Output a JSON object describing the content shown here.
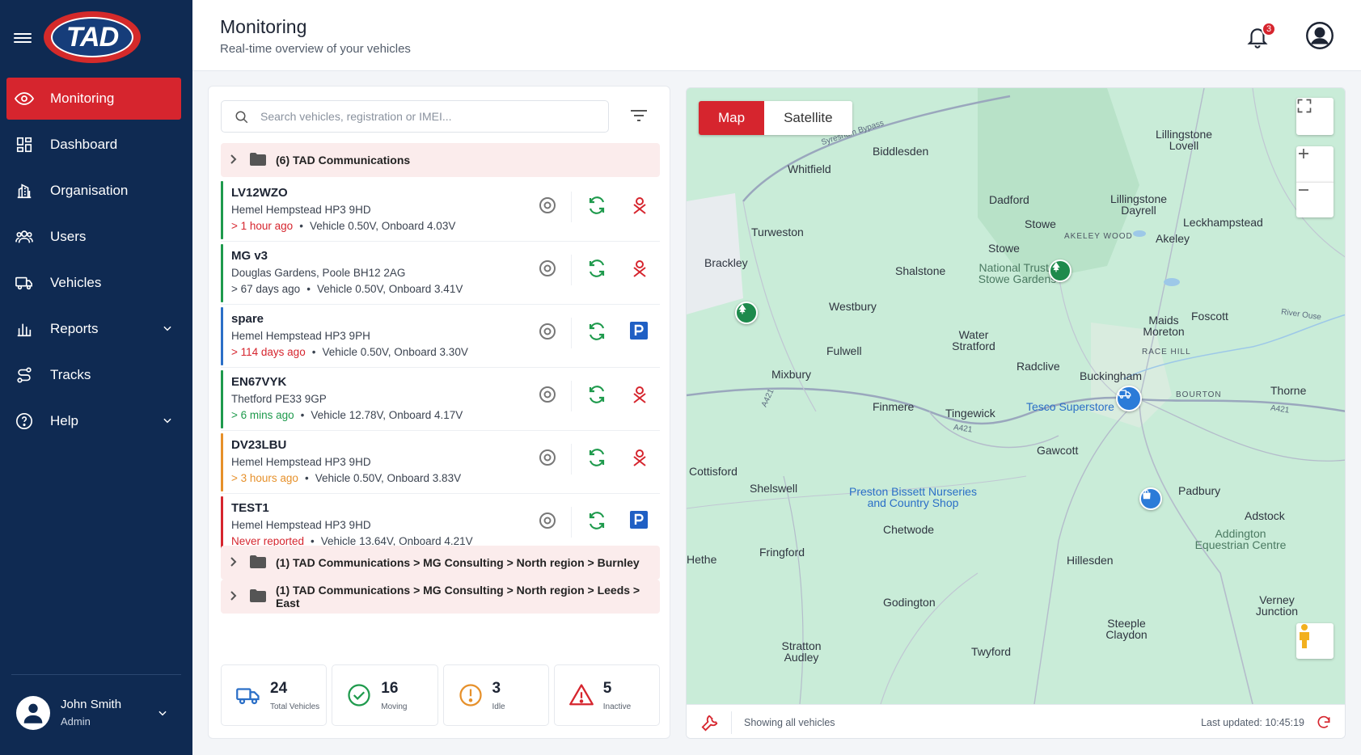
{
  "sidebar": {
    "logo_text": "TAD",
    "items": [
      {
        "label": "Monitoring",
        "icon": "eye-icon",
        "active": true
      },
      {
        "label": "Dashboard",
        "icon": "dashboard-grid-icon"
      },
      {
        "label": "Organisation",
        "icon": "building-icon"
      },
      {
        "label": "Users",
        "icon": "users-icon"
      },
      {
        "label": "Vehicles",
        "icon": "truck-icon"
      },
      {
        "label": "Reports",
        "icon": "bar-chart-icon",
        "expandable": true
      },
      {
        "label": "Tracks",
        "icon": "route-icon"
      },
      {
        "label": "Help",
        "icon": "help-circle-icon",
        "expandable": true
      }
    ],
    "user": {
      "name": "John Smith",
      "role": "Admin"
    }
  },
  "header": {
    "title": "Monitoring",
    "subtitle": "Real-time overview of your vehicles",
    "notification_count": "3"
  },
  "panel": {
    "search_placeholder": "Search vehicles, registration or IMEI...",
    "groups": [
      {
        "label": "(6) TAD Communications"
      },
      {
        "label": "(1) TAD Communications > MG Consulting > North region > Burnley"
      },
      {
        "label": "(1) TAD Communications > MG Consulting > North region > Leeds > East"
      }
    ],
    "vehicles": [
      {
        "name": "LV12WZO",
        "address": "Hemel Hempstead HP3 9HD",
        "time": "> 1 hour ago",
        "time_color": "#d6252e",
        "volts": "Vehicle 0.50V, Onboard 4.03V",
        "bar_color": "#1e9a4c",
        "status": "alert-icon"
      },
      {
        "name": "MG v3",
        "address": "Douglas Gardens, Poole BH12 2AG",
        "time": "> 67 days ago",
        "time_color": "#3b4350",
        "volts": "Vehicle 0.50V, Onboard 3.41V",
        "bar_color": "#1e9a4c",
        "status": "alert-icon"
      },
      {
        "name": "spare",
        "address": "Hemel Hempstead HP3 9PH",
        "time": "> 114 days ago",
        "time_color": "#d6252e",
        "volts": "Vehicle 0.50V, Onboard 3.30V",
        "bar_color": "#2b6fc7",
        "status": "parking-icon"
      },
      {
        "name": "EN67VYK",
        "address": "Thetford PE33 9GP",
        "time": "> 6 mins ago",
        "time_color": "#1e9a4c",
        "volts": "Vehicle 12.78V, Onboard 4.17V",
        "bar_color": "#1e9a4c",
        "status": "alert-icon"
      },
      {
        "name": "DV23LBU",
        "address": "Hemel Hempstead HP3 9HD",
        "time": "> 3 hours ago",
        "time_color": "#e6902a",
        "volts": "Vehicle 0.50V, Onboard 3.83V",
        "bar_color": "#e6902a",
        "status": "alert-icon"
      },
      {
        "name": "TEST1",
        "address": "Hemel Hempstead HP3 9HD",
        "time": "Never reported",
        "time_color": "#d6252e",
        "volts": "Vehicle 13.64V, Onboard 4.21V",
        "bar_color": "#d6252e",
        "status": "parking-icon"
      }
    ],
    "stats": [
      {
        "value": "24",
        "label": "Total Vehicles",
        "icon": "truck-icon",
        "color": "#2b6fc7"
      },
      {
        "value": "16",
        "label": "Moving",
        "icon": "check-circle-icon",
        "color": "#1e9a4c"
      },
      {
        "value": "3",
        "label": "Idle",
        "icon": "clock-alert-icon",
        "color": "#e6902a"
      },
      {
        "value": "5",
        "label": "Inactive",
        "icon": "warning-triangle-icon",
        "color": "#d6252e"
      }
    ]
  },
  "map": {
    "toggle": {
      "map": "Map",
      "satellite": "Satellite"
    },
    "labels": [
      {
        "text": "Biddlesden"
      },
      {
        "text": "Whitfield"
      },
      {
        "text": "Lillingstone Lovell"
      },
      {
        "text": "Dadford"
      },
      {
        "text": "Lillingstone Dayrell"
      },
      {
        "text": "Turweston"
      },
      {
        "text": "Stowe"
      },
      {
        "text": "Leckhampstead"
      },
      {
        "text": "AKELEY WOOD"
      },
      {
        "text": "Akeley"
      },
      {
        "text": "Brackley"
      },
      {
        "text": "Stowe"
      },
      {
        "text": "Shalstone"
      },
      {
        "text": "National Trust - Stowe Gardens"
      },
      {
        "text": "Westbury"
      },
      {
        "text": "Foscott"
      },
      {
        "text": "Maids Moreton"
      },
      {
        "text": "Water Stratford"
      },
      {
        "text": "RACE HILL"
      },
      {
        "text": "Fulwell"
      },
      {
        "text": "Radclive"
      },
      {
        "text": "Mixbury"
      },
      {
        "text": "Buckingham"
      },
      {
        "text": "Thorne"
      },
      {
        "text": "Finmere"
      },
      {
        "text": "Tingewick"
      },
      {
        "text": "Tesco Superstore"
      },
      {
        "text": "BOURTON"
      },
      {
        "text": "Gawcott"
      },
      {
        "text": "Cottisford"
      },
      {
        "text": "Shelswell"
      },
      {
        "text": "Preston Bissett Nurseries and Country Shop"
      },
      {
        "text": "Padbury"
      },
      {
        "text": "Adstock"
      },
      {
        "text": "Addington Equestrian Centre"
      },
      {
        "text": "Hethe"
      },
      {
        "text": "Chetwode"
      },
      {
        "text": "Fringford"
      },
      {
        "text": "Hillesden"
      },
      {
        "text": "Godington"
      },
      {
        "text": "Verney Junction"
      },
      {
        "text": "Steeple Claydon"
      },
      {
        "text": "Stratton Audley"
      },
      {
        "text": "Twyford"
      },
      {
        "text": "A421"
      },
      {
        "text": "A421"
      },
      {
        "text": "A421"
      },
      {
        "text": "Syresham Bypass"
      },
      {
        "text": "River Ouse"
      }
    ],
    "footer_text": "Showing all vehicles",
    "last_updated": "Last updated: 10:45:19"
  }
}
